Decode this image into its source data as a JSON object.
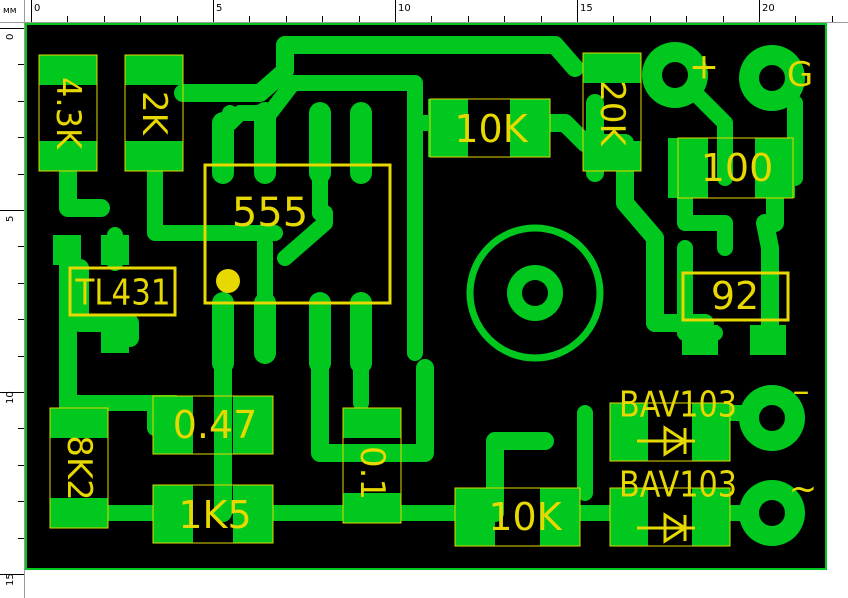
{
  "ruler": {
    "unit": "мм",
    "top_labels": [
      "0",
      "5",
      "10",
      "15",
      "20"
    ],
    "left_labels": [
      "0",
      "5",
      "10",
      "15"
    ]
  },
  "colors": {
    "copper": "#00c81e",
    "board": "#000000",
    "silkscreen": "#e6d800",
    "background": "#ffffff"
  },
  "components": {
    "r_43k": "4.3K",
    "r_2k": "2K",
    "ic_555": "555",
    "r_10k_top": "10K",
    "r_20k": "20K",
    "pad_plus": "+",
    "pad_g": "G",
    "r_100": "100",
    "tl431": "TL431",
    "r_92": "92",
    "r_8k2": "8K2",
    "c_047": "0.47",
    "c_01": "0.1",
    "r_1k5": "1K5",
    "r_10k_bottom": "10K",
    "diode_1": "BAV103",
    "diode_2": "BAV103",
    "pad_minus": "–",
    "pad_ac": "~"
  }
}
